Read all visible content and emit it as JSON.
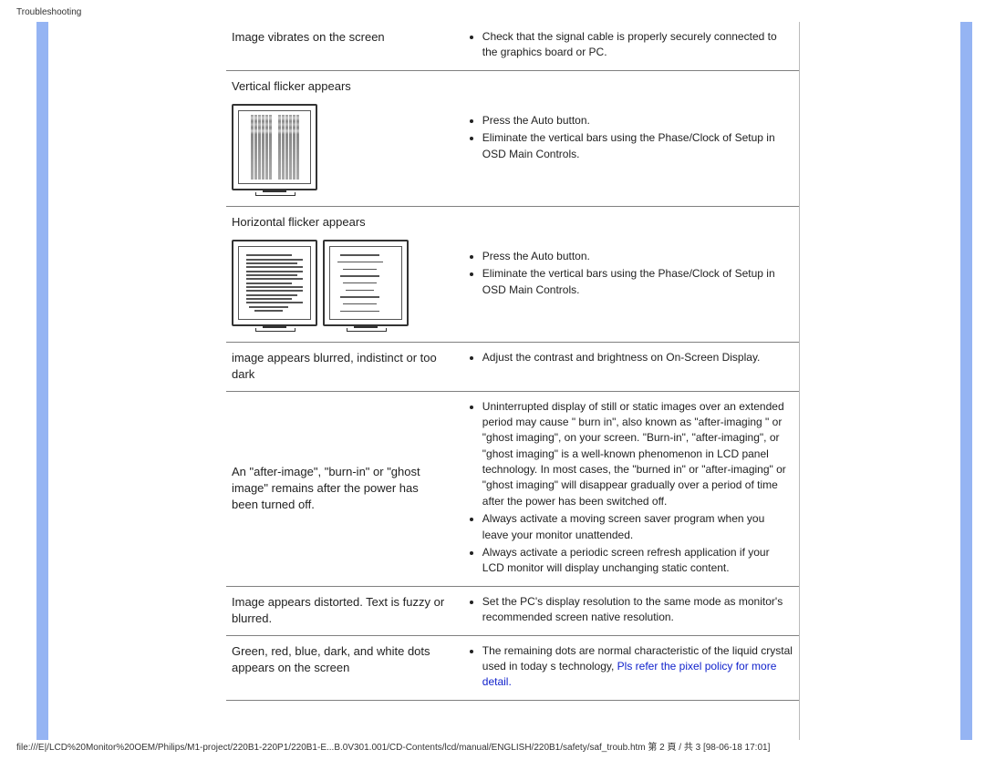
{
  "header": {
    "title": "Troubleshooting"
  },
  "footer": {
    "text": "file:///E|/LCD%20Monitor%20OEM/Philips/M1-project/220B1-220P1/220B1-E...B.0V301.001/CD-Contents/lcd/manual/ENGLISH/220B1/safety/saf_troub.htm 第 2 頁 / 共 3 [98-06-18 17:01]"
  },
  "rows": [
    {
      "problem": "Image vibrates on the screen",
      "solutions": [
        "Check that the signal cable is properly securely connected to the graphics board or PC."
      ]
    },
    {
      "problem": "Vertical flicker appears",
      "solutions": [
        "Press the Auto button.",
        "Eliminate the vertical bars using the Phase/Clock of Setup in OSD Main Controls."
      ]
    },
    {
      "problem": "Horizontal flicker appears",
      "solutions": [
        "Press the Auto button.",
        "Eliminate the vertical bars using the Phase/Clock of Setup in OSD Main Controls."
      ]
    },
    {
      "problem": "image appears blurred, indistinct or too dark",
      "solutions": [
        "Adjust the contrast and brightness on On-Screen Display."
      ]
    },
    {
      "problem": "An \"after-image\", \"burn-in\" or \"ghost image\" remains after the power has been turned off.",
      "solutions": [
        "Uninterrupted display of still or static images over an extended period may cause \" burn in\", also known as \"after-imaging \" or \"ghost imaging\", on your screen. \"Burn-in\", \"after-imaging\", or \"ghost imaging\" is a well-known phenomenon in LCD panel technology. In most cases, the \"burned in\" or \"after-imaging\" or \"ghost imaging\" will disappear gradually over a period of time after the power has been switched off.",
        "Always activate a moving screen saver program when you leave your monitor unattended.",
        "Always activate a periodic screen refresh application if your LCD monitor will display unchanging static content."
      ]
    },
    {
      "problem": "Image appears distorted. Text   is fuzzy or blurred.",
      "solutions": [
        "Set the PC's display resolution to the same mode as monitor's recommended screen native resolution."
      ]
    },
    {
      "problem": "Green, red, blue, dark, and white dots appears on the screen",
      "solutions_prefix": "The remaining dots are normal characteristic of the liquid crystal used in today s technology, ",
      "solutions_link": "Pls refer the pixel policy for more detail."
    }
  ]
}
